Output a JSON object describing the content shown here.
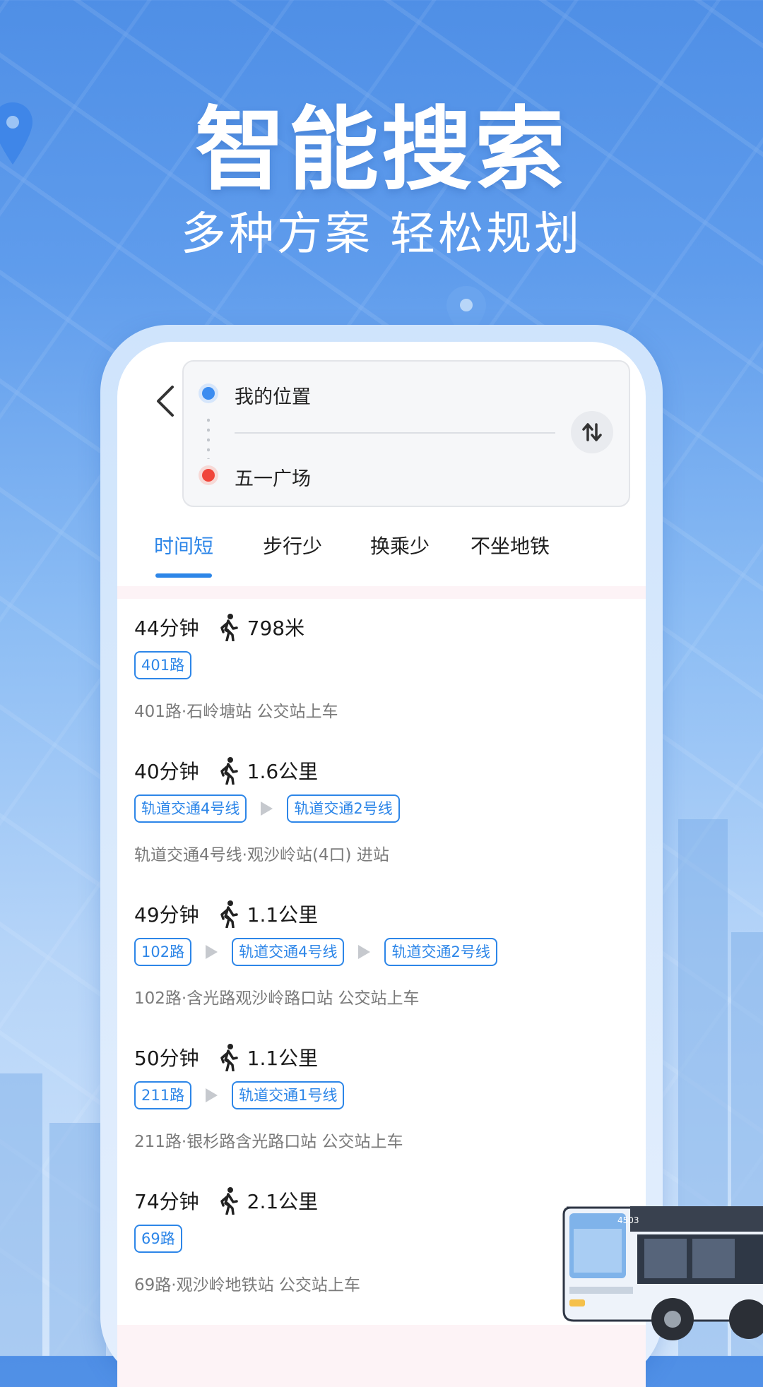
{
  "hero": {
    "title": "智能搜索",
    "subtitle": "多种方案 轻松规划"
  },
  "route": {
    "from": "我的位置",
    "to": "五一广场"
  },
  "tabs": [
    {
      "label": "时间短",
      "active": true
    },
    {
      "label": "步行少",
      "active": false
    },
    {
      "label": "换乘少",
      "active": false
    },
    {
      "label": "不坐地铁",
      "active": false
    }
  ],
  "results": [
    {
      "time": "44分钟",
      "walk": "798米",
      "lines": [
        "401路"
      ],
      "desc": "401路·石岭塘站 公交站上车"
    },
    {
      "time": "40分钟",
      "walk": "1.6公里",
      "lines": [
        "轨道交通4号线",
        "轨道交通2号线"
      ],
      "desc": "轨道交通4号线·观沙岭站(4口) 进站"
    },
    {
      "time": "49分钟",
      "walk": "1.1公里",
      "lines": [
        "102路",
        "轨道交通4号线",
        "轨道交通2号线"
      ],
      "desc": "102路·含光路观沙岭路口站 公交站上车"
    },
    {
      "time": "50分钟",
      "walk": "1.1公里",
      "lines": [
        "211路",
        "轨道交通1号线"
      ],
      "desc": "211路·银杉路含光路口站 公交站上车"
    },
    {
      "time": "74分钟",
      "walk": "2.1公里",
      "lines": [
        "69路"
      ],
      "desc": "69路·观沙岭地铁站 公交站上车"
    }
  ],
  "bus": {
    "number": "4503"
  },
  "colors": {
    "accent": "#2d86e8",
    "origin": "#3b8cf0",
    "destination": "#f0453a"
  }
}
